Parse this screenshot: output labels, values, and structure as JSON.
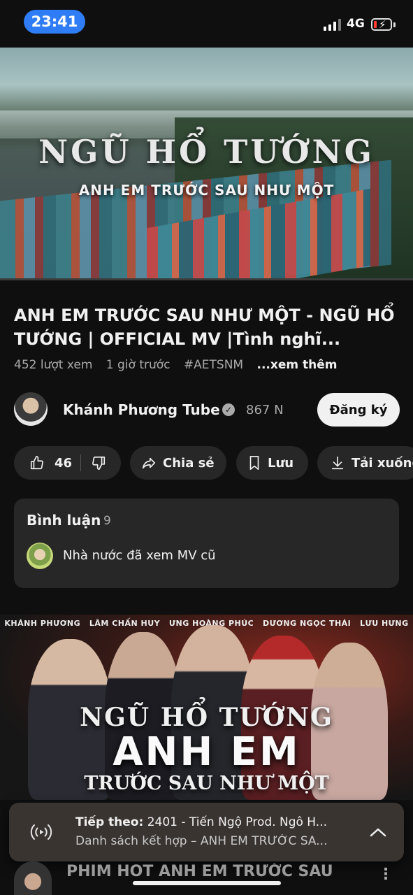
{
  "status_bar": {
    "time": "23:41",
    "network": "4G",
    "battery_level": 0.15,
    "battery_charging": true
  },
  "video": {
    "art_title": "NGŨ HỔ TƯỚNG",
    "art_subtitle": "ANH EM TRƯỚC SAU NHƯ MỘT",
    "progress": 0.0,
    "title": "ANH EM TRƯỚC SAU NHƯ MỘT - NGŨ HỔ TƯỚNG | OFFICIAL MV |Tình nghĩ...",
    "views": "452 lượt xem",
    "age": "1 giờ trước",
    "hashtag": "#AETSNM",
    "more": "...xem thêm"
  },
  "channel": {
    "name": "Khánh Phương Tube",
    "verified_icon": "verified-check-icon",
    "subscribers": "867 N",
    "subscribe_label": "Đăng ký"
  },
  "actions": {
    "like_count": "46",
    "share_label": "Chia sẻ",
    "save_label": "Lưu",
    "download_label": "Tải xuống"
  },
  "comments": {
    "title": "Bình luận",
    "count": "9",
    "top_comment": "Nhà nước đã xem MV cũ"
  },
  "next_video": {
    "cast": [
      "KHÁNH PHƯƠNG",
      "LÂM CHẤN HUY",
      "ƯNG HOÀNG PHÚC",
      "DƯƠNG NGỌC THÁI",
      "LƯU HƯNG"
    ],
    "poster_line1": "NGŨ HỔ TƯỚNG",
    "poster_line2": "ANH EM",
    "poster_line3": "TRƯỚC SAU NHƯ MỘT",
    "peek_title": "PHIM HOT ANH EM TRƯỚC SAU"
  },
  "up_next": {
    "label": "Tiếp theo:",
    "title": "2401 - Tiến Ngộ Prod. Ngô H...",
    "playlist": "Danh sách kết hợp – ANH EM TRƯỚC SA..."
  },
  "colors": {
    "accent": "#2f7df6",
    "background": "#0f0f0f",
    "chip": "#272727",
    "progress": "#ff0000"
  }
}
